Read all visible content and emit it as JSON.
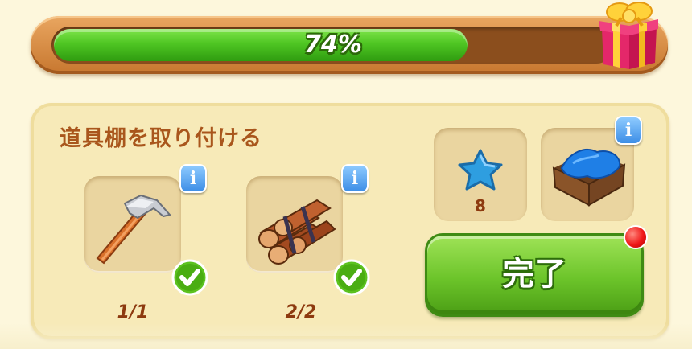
{
  "progress": {
    "value": 0.74,
    "label": "74%"
  },
  "quest": {
    "title": "道具棚を取り付ける",
    "requirements": [
      {
        "name": "hammer",
        "icon": "hammer-icon",
        "count": "1/1",
        "completed": true
      },
      {
        "name": "logs",
        "icon": "log-bundle-icon",
        "count": "2/2",
        "completed": true
      }
    ],
    "rewards": [
      {
        "name": "blue-star",
        "icon": "star-icon",
        "amount": "8"
      },
      {
        "name": "blue-cloth-crate",
        "icon": "crate-icon",
        "amount": ""
      }
    ],
    "complete_label": "完了"
  },
  "colors": {
    "progress_fill": "#4fc623",
    "frame": "#c7772f",
    "title": "#a9561c",
    "button": "#6cc42a",
    "info": "#3d8ee6",
    "notification": "#f01818"
  }
}
